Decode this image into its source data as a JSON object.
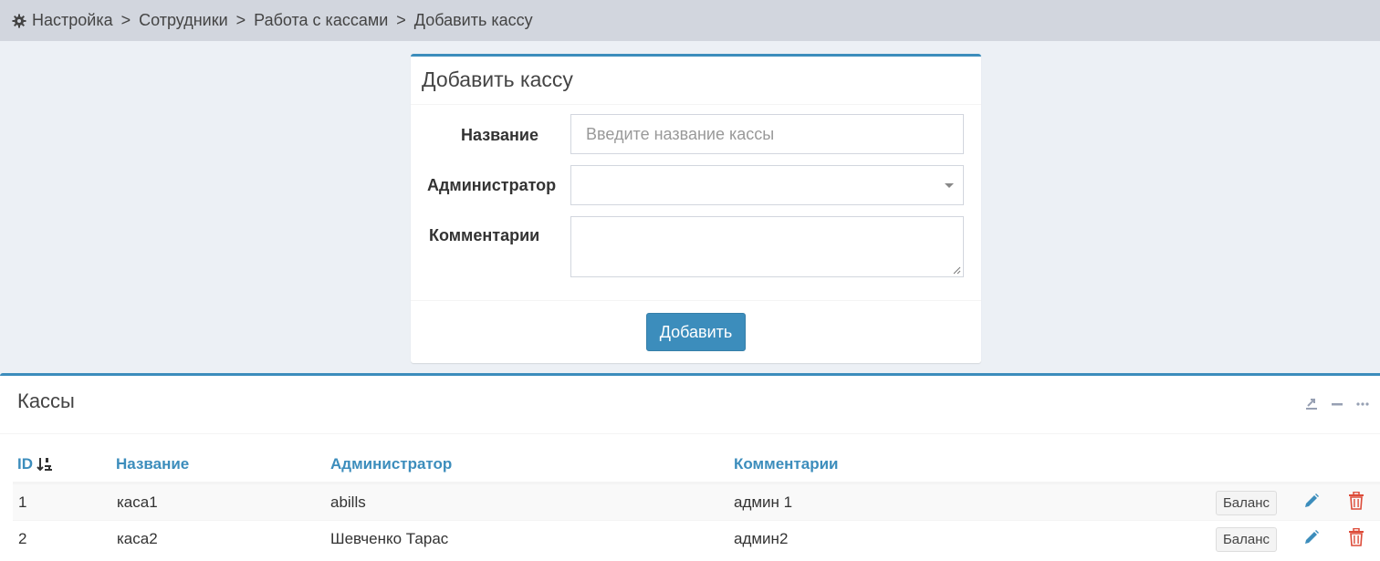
{
  "breadcrumb": {
    "items": [
      "Настройка",
      "Сотрудники",
      "Работа с кассами",
      "Добавить кассу"
    ],
    "separator": ">"
  },
  "form": {
    "title": "Добавить кассу",
    "name_label": "Название",
    "name_placeholder": "Введите название кассы",
    "admin_label": "Администратор",
    "admin_value": "",
    "comment_label": "Комментарии",
    "submit_label": "Добавить"
  },
  "table": {
    "title": "Кассы",
    "columns": [
      "ID",
      "Название",
      "Администратор",
      "Комментарии"
    ],
    "rows": [
      {
        "id": "1",
        "name": "каса1",
        "admin": "abills",
        "comment": "админ 1",
        "balance_label": "Баланс"
      },
      {
        "id": "2",
        "name": "каса2",
        "admin": "Шевченко Тарас",
        "comment": "админ2",
        "balance_label": "Баланс"
      }
    ]
  },
  "colors": {
    "accent": "#3c8dbc",
    "danger": "#dd4b39",
    "background": "#ecf0f5",
    "breadcrumb_bg": "#d2d6de"
  },
  "icons": {
    "breadcrumb": "gear-icon",
    "sort": "sort-numeric-icon",
    "tools": [
      "export-icon",
      "minus-icon",
      "ellipsis-icon"
    ],
    "row_actions": [
      "pencil-icon",
      "trash-icon"
    ]
  }
}
